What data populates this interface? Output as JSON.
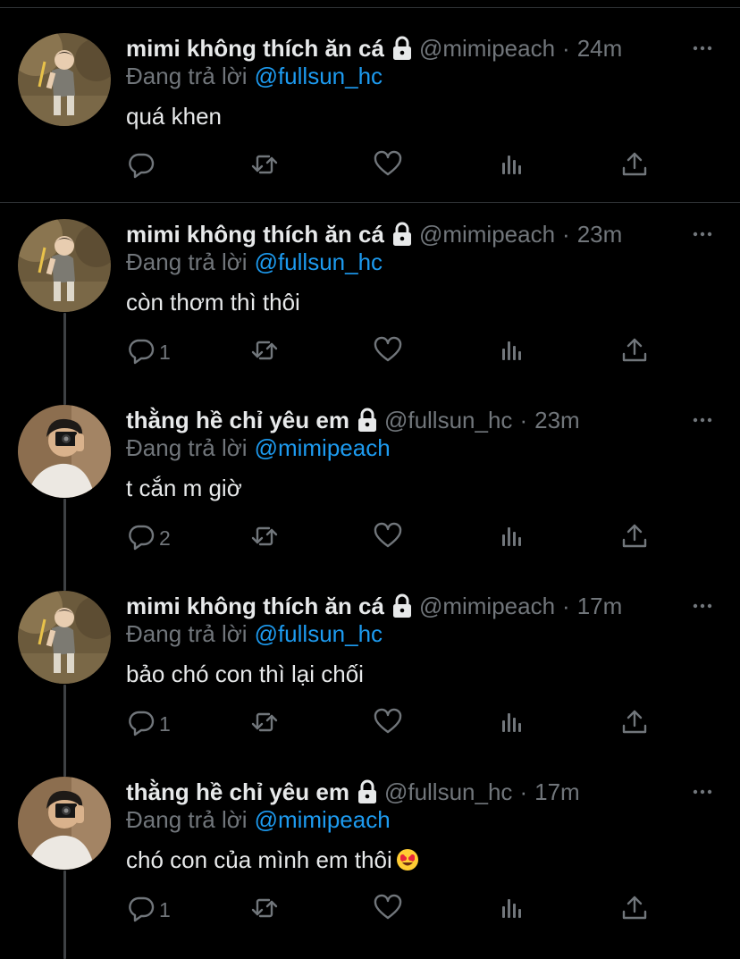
{
  "accent": "#1d9bf0",
  "secondary_text_color": "#71767b",
  "reply_prefix": "Đang trả lời",
  "tweets": [
    {
      "name": "mimi không thích ăn cá",
      "handle": "@mimipeach",
      "time": "24m",
      "replying_to": "@fullsun_hc",
      "text": "quá khen",
      "reply_count": "",
      "avatar": "mimi-avatar"
    },
    {
      "name": "mimi không thích ăn cá",
      "handle": "@mimipeach",
      "time": "23m",
      "replying_to": "@fullsun_hc",
      "text": "còn thơm thì thôi",
      "reply_count": "1",
      "avatar": "mimi-avatar"
    },
    {
      "name": "thằng hề chỉ yêu em",
      "handle": "@fullsun_hc",
      "time": "23m",
      "replying_to": "@mimipeach",
      "text": "t cắn m giờ",
      "reply_count": "2",
      "avatar": "fullsun-avatar"
    },
    {
      "name": "mimi không thích ăn cá",
      "handle": "@mimipeach",
      "time": "17m",
      "replying_to": "@fullsun_hc",
      "text": "bảo chó con thì lại chối",
      "reply_count": "1",
      "avatar": "mimi-avatar"
    },
    {
      "name": "thằng hề chỉ yêu em",
      "handle": "@fullsun_hc",
      "time": "17m",
      "replying_to": "@mimipeach",
      "text": "chó con của mình em thôi",
      "text_emoji": "heart-eyes-emoji",
      "reply_count": "1",
      "avatar": "fullsun-avatar"
    }
  ]
}
